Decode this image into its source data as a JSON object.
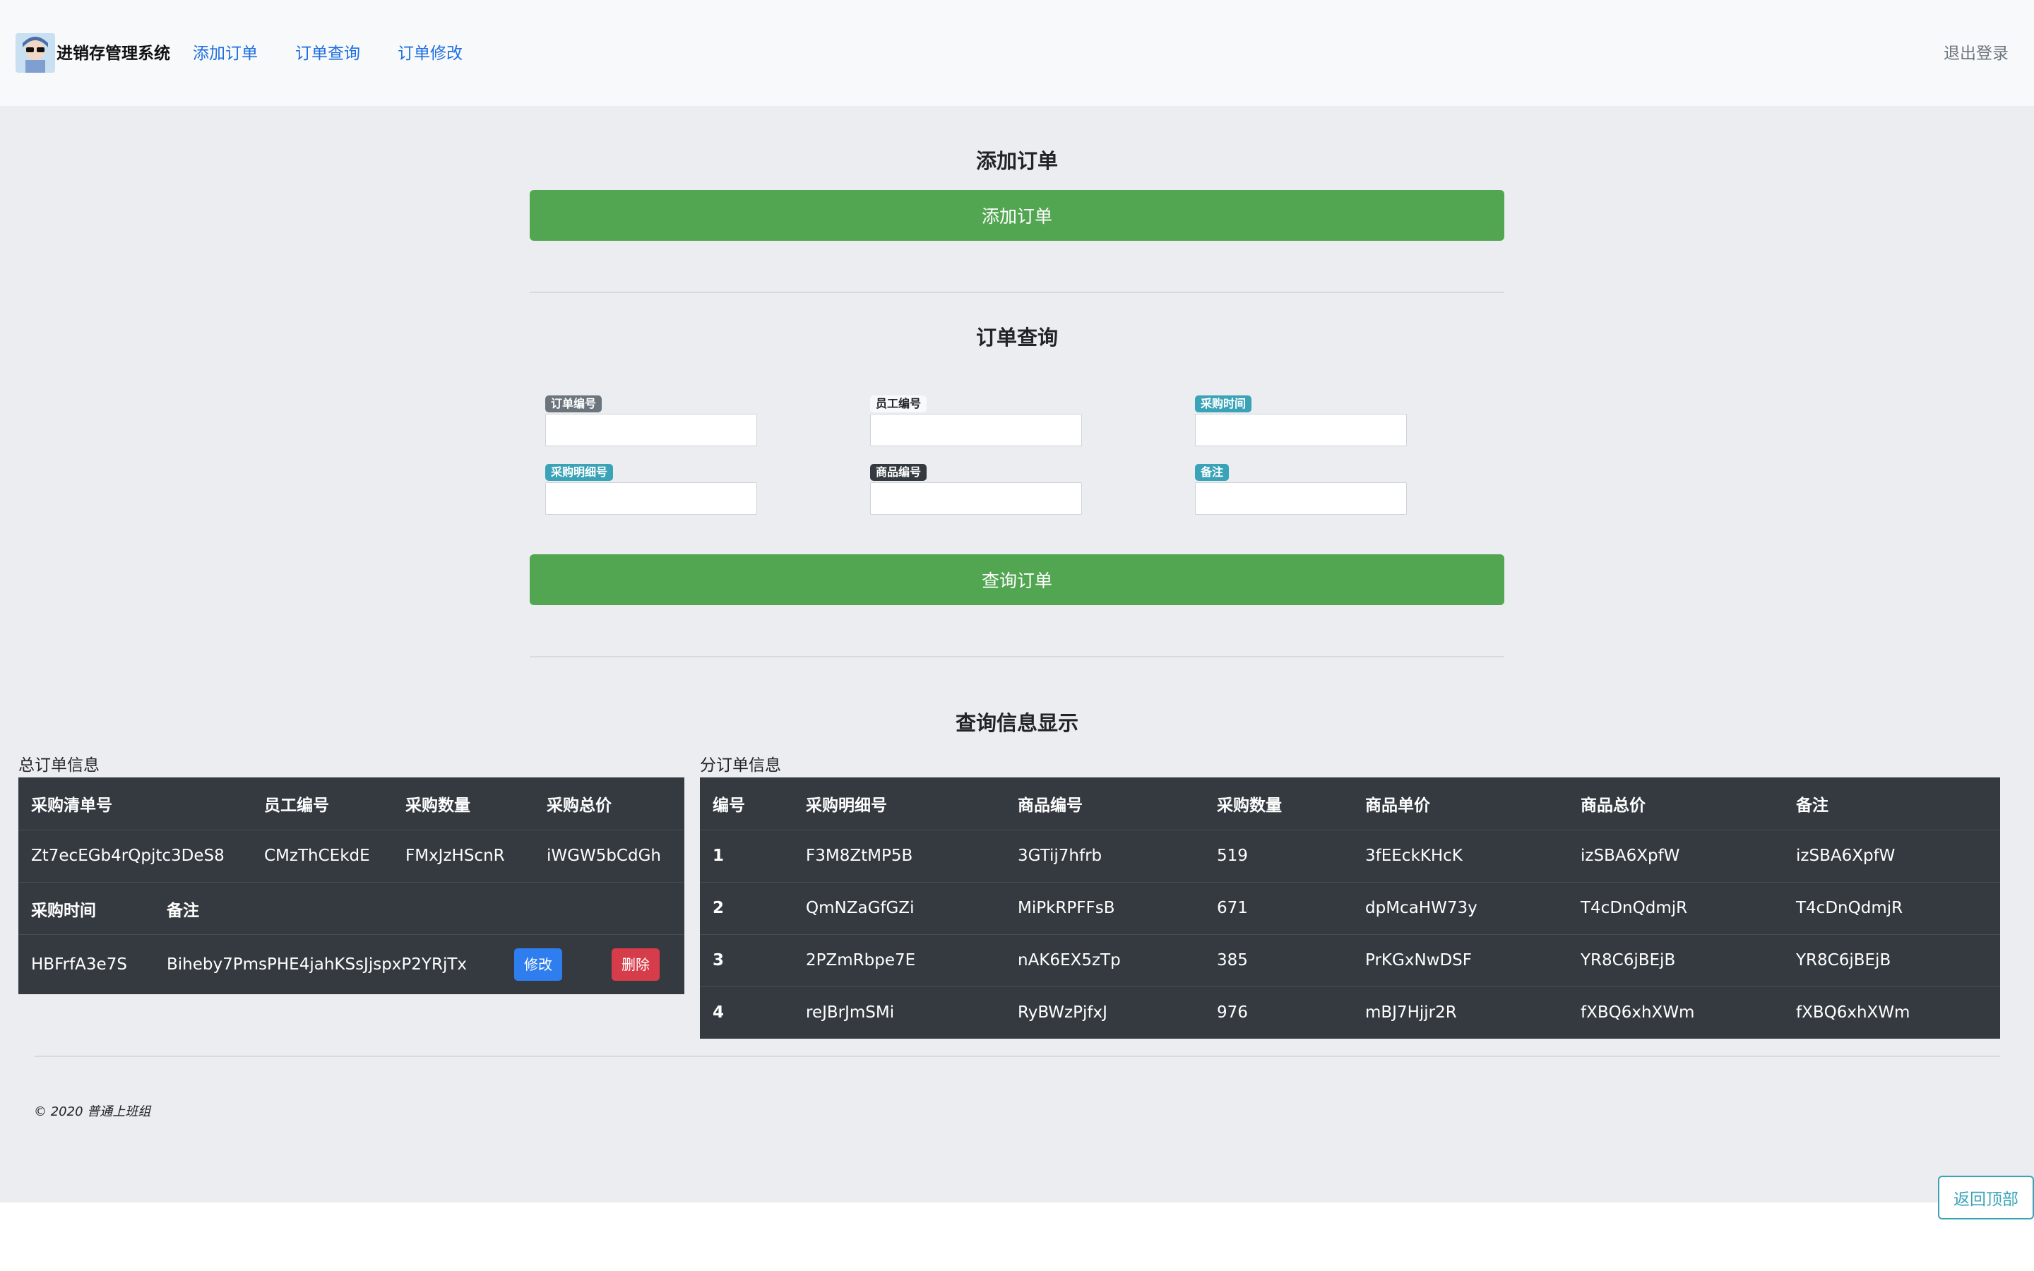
{
  "navbar": {
    "brand": "进销存管理系统",
    "links": [
      "添加订单",
      "订单查询",
      "订单修改"
    ],
    "logout": "退出登录"
  },
  "add_section": {
    "title": "添加订单",
    "button": "添加订单"
  },
  "query_section": {
    "title": "订单查询",
    "fields": [
      {
        "label": "订单编号",
        "value": "",
        "placeholder": ""
      },
      {
        "label": "员工编号",
        "value": "",
        "placeholder": ""
      },
      {
        "label": "采购时间",
        "value": "",
        "placeholder": ""
      },
      {
        "label": "采购明细号",
        "value": "",
        "placeholder": ""
      },
      {
        "label": "商品编号",
        "value": "",
        "placeholder": ""
      },
      {
        "label": "备注",
        "value": "",
        "placeholder": ""
      }
    ],
    "button": "查询订单"
  },
  "results": {
    "title": "查询信息显示",
    "total": {
      "caption": "总订单信息",
      "header1": [
        "采购清单号",
        "员工编号",
        "采购数量",
        "采购总价"
      ],
      "row1": [
        "Zt7ecEGb4rQpjtc3DeS8",
        "CMzThCEkdE",
        "FMxJzHScnR",
        "iWGW5bCdGh"
      ],
      "header2": [
        "采购时间",
        "备注"
      ],
      "row2": [
        "HBFrfA3e7S",
        "Biheby7PmsPHE4jahKSsJjspxP2YRjTx"
      ],
      "edit_button": "修改",
      "delete_button": "删除"
    },
    "detail": {
      "caption": "分订单信息",
      "headers": [
        "编号",
        "采购明细号",
        "商品编号",
        "采购数量",
        "商品单价",
        "商品总价",
        "备注"
      ],
      "rows": [
        [
          "1",
          "F3M8ZtMP5B",
          "3GTij7hfrb",
          "519",
          "3fEEckKHcK",
          "izSBA6XpfW",
          "izSBA6XpfW"
        ],
        [
          "2",
          "QmNZaGfGZi",
          "MiPkRPFFsB",
          "671",
          "dpMcaHW73y",
          "T4cDnQdmjR",
          "T4cDnQdmjR"
        ],
        [
          "3",
          "2PZmRbpe7E",
          "nAK6EX5zTp",
          "385",
          "PrKGxNwDSF",
          "YR8C6jBEjB",
          "YR8C6jBEjB"
        ],
        [
          "4",
          "reJBrJmSMi",
          "RyBWzPjfxJ",
          "976",
          "mBJ7Hjjr2R",
          "fXBQ6xhXWm",
          "fXBQ6xhXWm"
        ]
      ]
    }
  },
  "footer": {
    "text": "© 2020 普通上班组",
    "back_to_top": "返回顶部"
  },
  "colors": {
    "primary_green": "#52a551",
    "link_blue": "#1f6fe0",
    "table_dark": "#343a40",
    "teal": "#3aa3b8",
    "danger_red": "#d73c4a"
  }
}
